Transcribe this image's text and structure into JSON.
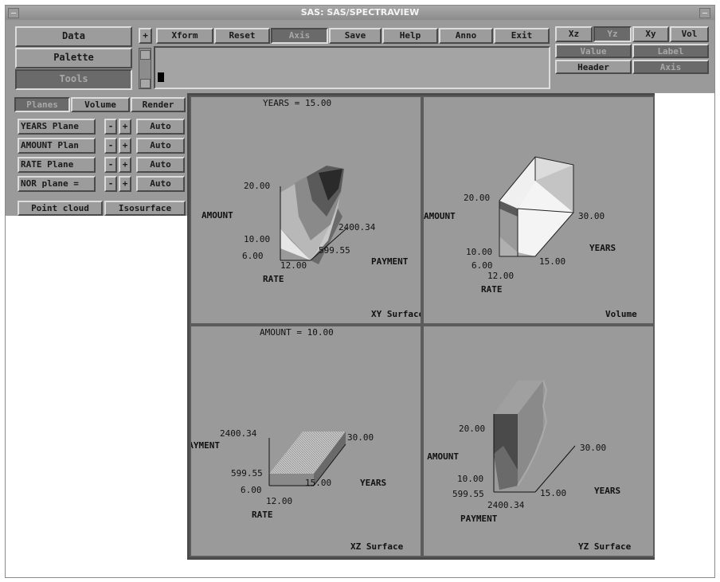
{
  "window": {
    "title": "SAS: SAS/SPECTRAVIEW"
  },
  "left_menu": [
    "Data",
    "Palette",
    "Tools"
  ],
  "plus_label": "+",
  "toolbar": [
    "Xform",
    "Reset",
    "Axis",
    "Save",
    "Help",
    "Anno",
    "Exit"
  ],
  "view_buttons": [
    "Xz",
    "Yz",
    "Xy",
    "Vol"
  ],
  "right_buttons": {
    "value": "Value",
    "label": "Label",
    "header": "Header",
    "axis": "Axis"
  },
  "tabs": [
    "Planes",
    "Volume",
    "Render"
  ],
  "planes": [
    {
      "label": "YEARS Plane",
      "minus": "-",
      "plus": "+",
      "auto": "Auto"
    },
    {
      "label": "AMOUNT Plan",
      "minus": "-",
      "plus": "+",
      "auto": "Auto"
    },
    {
      "label": "RATE Plane",
      "minus": "-",
      "plus": "+",
      "auto": "Auto"
    },
    {
      "label": "NOR plane =",
      "minus": "-",
      "plus": "+",
      "auto": "Auto"
    }
  ],
  "render_buttons": [
    "Point cloud",
    "Isosurface"
  ],
  "views": {
    "xy": {
      "header": "YEARS = 15.00",
      "footer": "XY Surface",
      "labels": {
        "amount": "AMOUNT",
        "v20": "20.00",
        "v10": "10.00",
        "v6": "6.00",
        "v12": "12.00",
        "rate": "RATE",
        "v2400": "2400.34",
        "v599": "599.55",
        "payment": "PAYMENT"
      }
    },
    "vol": {
      "footer": "Volume",
      "labels": {
        "amount": "AMOUNT",
        "v20": "20.00",
        "v30": "30.00",
        "years": "YEARS",
        "v10": "10.00",
        "v6": "6.00",
        "v15": "15.00",
        "v12": "12.00",
        "rate": "RATE"
      }
    },
    "xz": {
      "header": "AMOUNT = 10.00",
      "footer": "XZ Surface",
      "labels": {
        "v2400": "2400.34",
        "payment": "PAYMENT",
        "v30": "30.00",
        "v599": "599.55",
        "v15": "15.00",
        "years": "YEARS",
        "v6": "6.00",
        "v12": "12.00",
        "rate": "RATE"
      }
    },
    "yz": {
      "footer": "YZ Surface",
      "labels": {
        "v20": "20.00",
        "amount": "AMOUNT",
        "v30": "30.00",
        "v10": "10.00",
        "v599": "599.55",
        "v15": "15.00",
        "years": "YEARS",
        "v2400": "2400.34",
        "payment": "PAYMENT"
      }
    }
  }
}
